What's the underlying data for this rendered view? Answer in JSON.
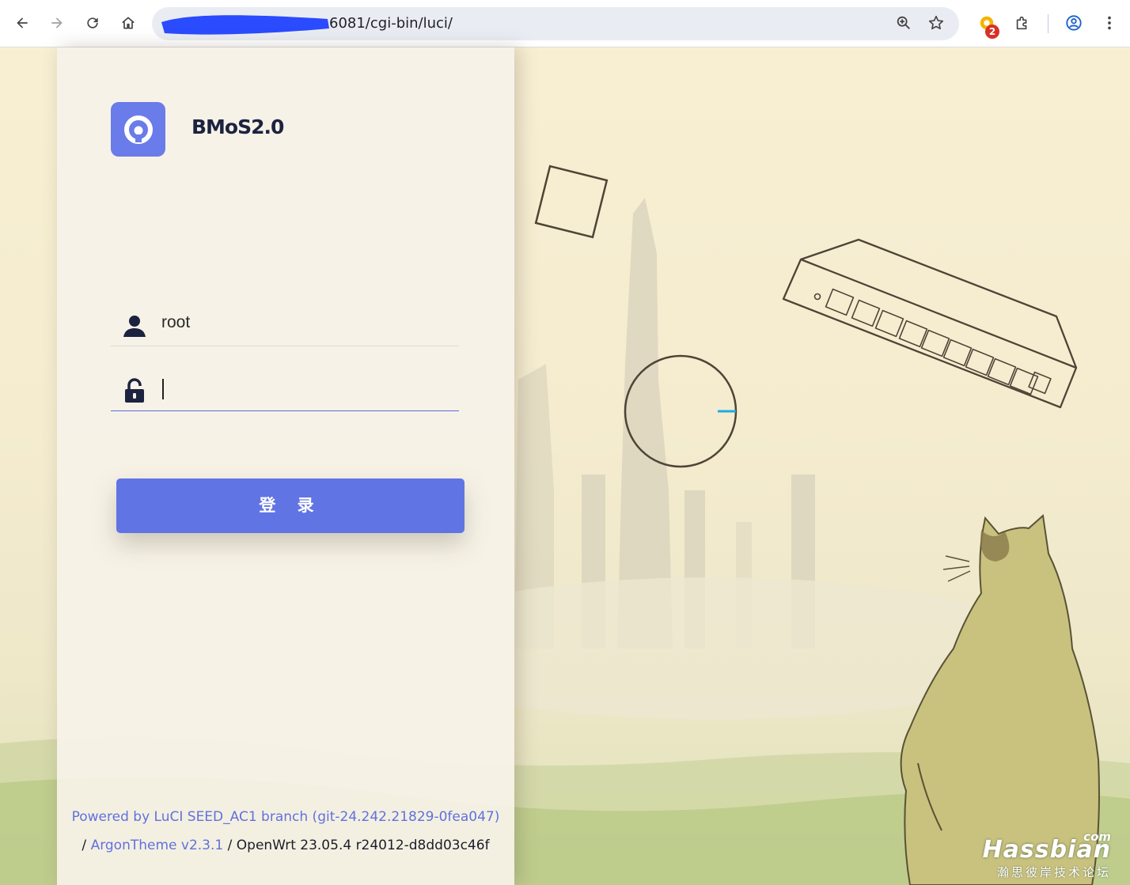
{
  "browser": {
    "url": "6081/cgi-bin/luci/",
    "extension_badge": "2",
    "icons": {
      "back": "back-arrow-icon",
      "forward": "forward-arrow-icon",
      "reload": "reload-icon",
      "home": "home-icon",
      "zoom": "zoom-icon",
      "bookmark": "star-icon",
      "extension": "extension-icon",
      "extensions_menu": "puzzle-icon",
      "profile": "profile-icon",
      "menu": "kebab-menu-icon"
    }
  },
  "login": {
    "brand_name": "BMoS2.0",
    "username_value": "root",
    "password_value": "",
    "submit_label": "登 录",
    "accent_color": "#6174e4"
  },
  "footer": {
    "powered_by": "Powered by LuCI SEED_AC1 branch (git-24.242.21829-0fea047)",
    "sep1": "/",
    "theme_link": "ArgonTheme v2.3.1",
    "sep2": "/",
    "openwrt": "OpenWrt 23.05.4 r24012-d8dd03c46f"
  },
  "watermark": {
    "com": "com",
    "main": "Hassbian",
    "sub": "瀚思彼岸技术论坛"
  }
}
